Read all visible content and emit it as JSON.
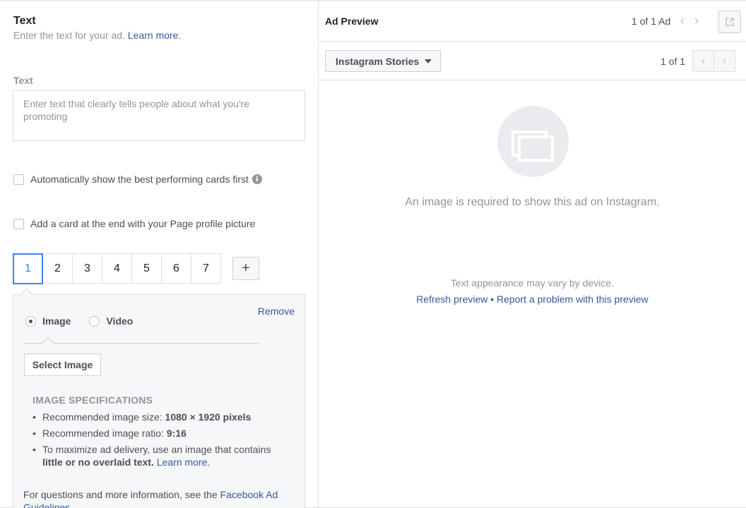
{
  "text_section": {
    "title": "Text",
    "subtitle": "Enter the text for your ad.",
    "learn_more": "Learn more.",
    "field_label": "Text",
    "placeholder": "Enter text that clearly tells people about what you're promoting",
    "value": ""
  },
  "options": {
    "auto_best_cards": "Automatically show the best performing cards first",
    "auto_best_cards_checked": false,
    "info_icon": "i",
    "end_card": "Add a card at the end with your Page profile picture",
    "end_card_checked": false
  },
  "cards": {
    "tabs": [
      "1",
      "2",
      "3",
      "4",
      "5",
      "6",
      "7"
    ],
    "active_index": 0,
    "add_label": "+"
  },
  "card_editor": {
    "remove": "Remove",
    "media_options": [
      "Image",
      "Video"
    ],
    "selected_media": "Image",
    "select_button": "Select Image",
    "spec_title": "IMAGE SPECIFICATIONS",
    "spec_size_prefix": "Recommended image size: ",
    "spec_size_value": "1080 × 1920 pixels",
    "spec_ratio_prefix": "Recommended image ratio: ",
    "spec_ratio_value": "9:16",
    "spec_overlay_prefix": "To maximize ad delivery, use an image that contains ",
    "spec_overlay_bold": "little or no overlaid text.",
    "spec_overlay_link": "Learn more.",
    "footnote_prefix": "For questions and more information, see the ",
    "footnote_link": "Facebook Ad Guidelines"
  },
  "preview": {
    "title": "Ad Preview",
    "ad_count": "1 of 1 Ad",
    "placement": "Instagram Stories",
    "page_count": "1 of 1",
    "missing_message": "An image is required to show this ad on Instagram.",
    "vary_message": "Text appearance may vary by device.",
    "refresh_link": "Refresh preview",
    "separator": "•",
    "report_link": "Report a problem with this preview"
  },
  "icons": {
    "chevron_left": "‹",
    "chevron_right": "›",
    "external": "external-link-icon",
    "image_placeholder": "image-placeholder-icon"
  },
  "colors": {
    "link": "#365899",
    "active_tab": "#4080ff",
    "muted": "#90949c",
    "panel_bg": "#f6f7f9"
  }
}
